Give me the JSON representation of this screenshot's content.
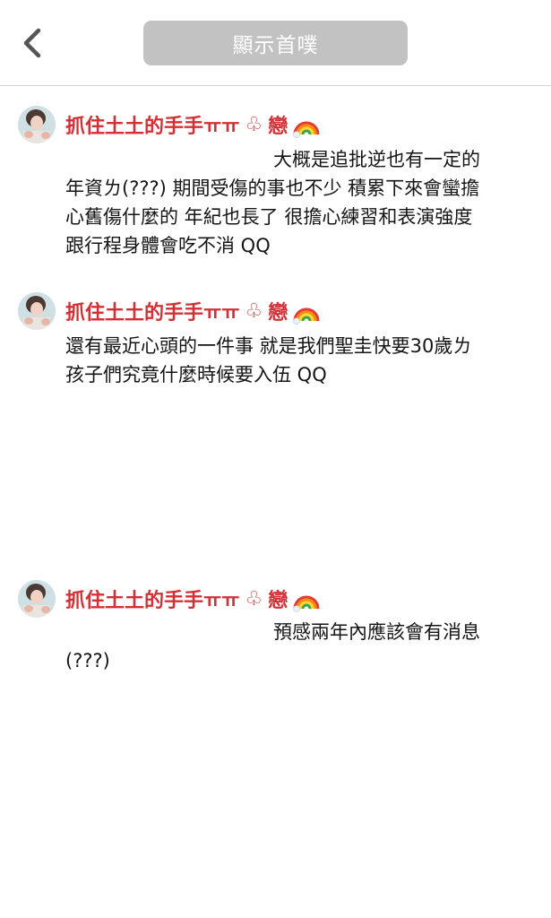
{
  "header": {
    "back_icon": "chevron-left-icon",
    "title": "顯示首噗"
  },
  "colors": {
    "author_red": "#d32f34",
    "title_button_bg": "#c2c2c2",
    "divider": "#d4d4d4"
  },
  "posts": [
    {
      "author": "抓住土土的手手ㅠㅠ",
      "club": "♧",
      "love": "戀",
      "emoji_icon": "rainbow-icon",
      "lines": [
        "大概是追批逆也有一定的",
        "年資ㄌ(???) 期間受傷的事也不少 積累下來會蠻擔",
        "心舊傷什麼的 年紀也長了 很擔心練習和表演強度",
        "跟行程身體會吃不消 QQ"
      ]
    },
    {
      "author": "抓住土土的手手ㅠㅠ",
      "club": "♧",
      "love": "戀",
      "emoji_icon": "rainbow-icon",
      "lines": [
        "還有最近心頭的一件事 就是我們聖圭快要30歲ㄌ",
        "孩子們究竟什麼時候要入伍 QQ"
      ]
    },
    {
      "author": "抓住土土的手手ㅠㅠ",
      "club": "♧",
      "love": "戀",
      "emoji_icon": "rainbow-icon",
      "lines": [
        "預感兩年內應該會有消息",
        "(???)"
      ]
    }
  ]
}
